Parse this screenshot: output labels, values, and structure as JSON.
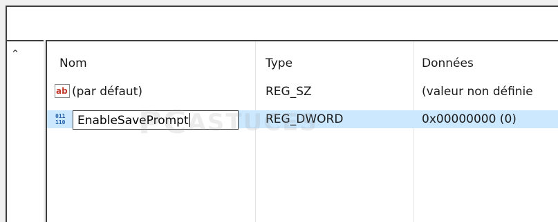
{
  "columns": {
    "name": "Nom",
    "type": "Type",
    "data": "Données"
  },
  "rows": [
    {
      "icon": "string-value-icon",
      "name": "(par défaut)",
      "type": "REG_SZ",
      "data": "(valeur non définie",
      "selected": false
    },
    {
      "icon": "dword-value-icon",
      "name": "EnableSavePrompt",
      "type": "REG_DWORD",
      "data": "0x00000000 (0)",
      "selected": true,
      "editing": true
    }
  ],
  "watermark": {
    "big": "PC",
    "small": "ASTUCES"
  },
  "colors": {
    "selection": "#cce8ff",
    "border": "#3c3c3c",
    "string_icon_red": "#c0392b",
    "dword_icon_blue": "#1e5fa8"
  }
}
